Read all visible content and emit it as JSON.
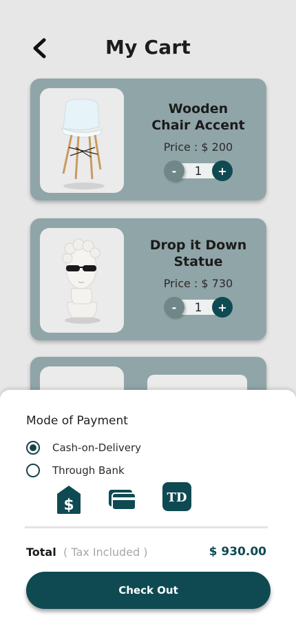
{
  "header": {
    "title": "My Cart",
    "back_icon": "chevron-left-icon"
  },
  "cart": {
    "items": [
      {
        "name_line1": "Wooden",
        "name_line2": "Chair Accent",
        "price": "Price : $ 200",
        "qty": "1",
        "image": "white-chair-image"
      },
      {
        "name_line1": "Drop it Down",
        "name_line2": "Statue",
        "price": "Price : $ 730",
        "qty": "1",
        "image": "statue-with-sunglasses-image"
      }
    ],
    "minus_label": "-",
    "plus_label": "+"
  },
  "payment": {
    "title": "Mode of Payment",
    "options": [
      {
        "label": "Cash-on-Delivery",
        "selected": true
      },
      {
        "label": "Through Bank",
        "selected": false
      }
    ],
    "bank_icons": [
      "bank-dollar-icon",
      "cards-icon",
      "td-bank-icon"
    ],
    "td_logo_text": "TD"
  },
  "total": {
    "label": "Total",
    "note": "( Tax Included )",
    "amount": "$ 930.00"
  },
  "checkout": {
    "label": "Check Out"
  },
  "colors": {
    "primary": "#0f4a52",
    "card_bg": "#90a5a8",
    "page_bg": "#e7e7e7"
  }
}
